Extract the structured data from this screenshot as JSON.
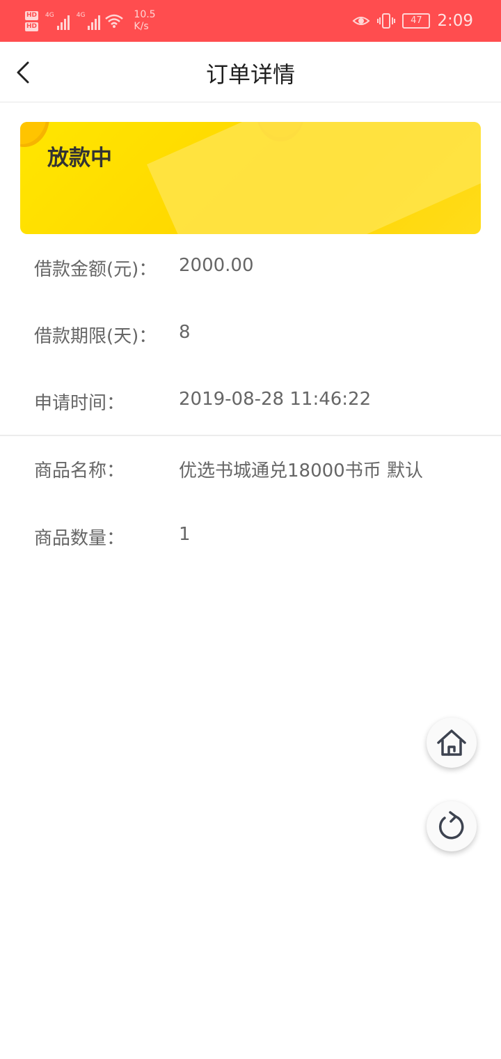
{
  "status_bar": {
    "sim1": "HD",
    "sim2": "HD",
    "net1": "4G",
    "net2": "4G",
    "speed_value": "10.5",
    "speed_unit": "K/s",
    "battery": "47",
    "time": "2:09"
  },
  "header": {
    "title": "订单详情"
  },
  "banner": {
    "status": "放款中"
  },
  "loan_info": [
    {
      "label": "借款金额(元)：",
      "value": "2000.00"
    },
    {
      "label": "借款期限(天)：",
      "value": "8"
    },
    {
      "label": "申请时间：",
      "value": "2019-08-28 11:46:22"
    }
  ],
  "product_info": [
    {
      "label": "商品名称：",
      "value": "优选书城通兑18000书币 默认"
    },
    {
      "label": "商品数量：",
      "value": "1"
    }
  ],
  "icons": {
    "back": "chevron-left-icon",
    "home": "home-icon",
    "refresh": "refresh-icon"
  },
  "colors": {
    "status_bar": "#ff4d4f",
    "banner_yellow": "#ffd500",
    "text_gray": "#666666"
  }
}
